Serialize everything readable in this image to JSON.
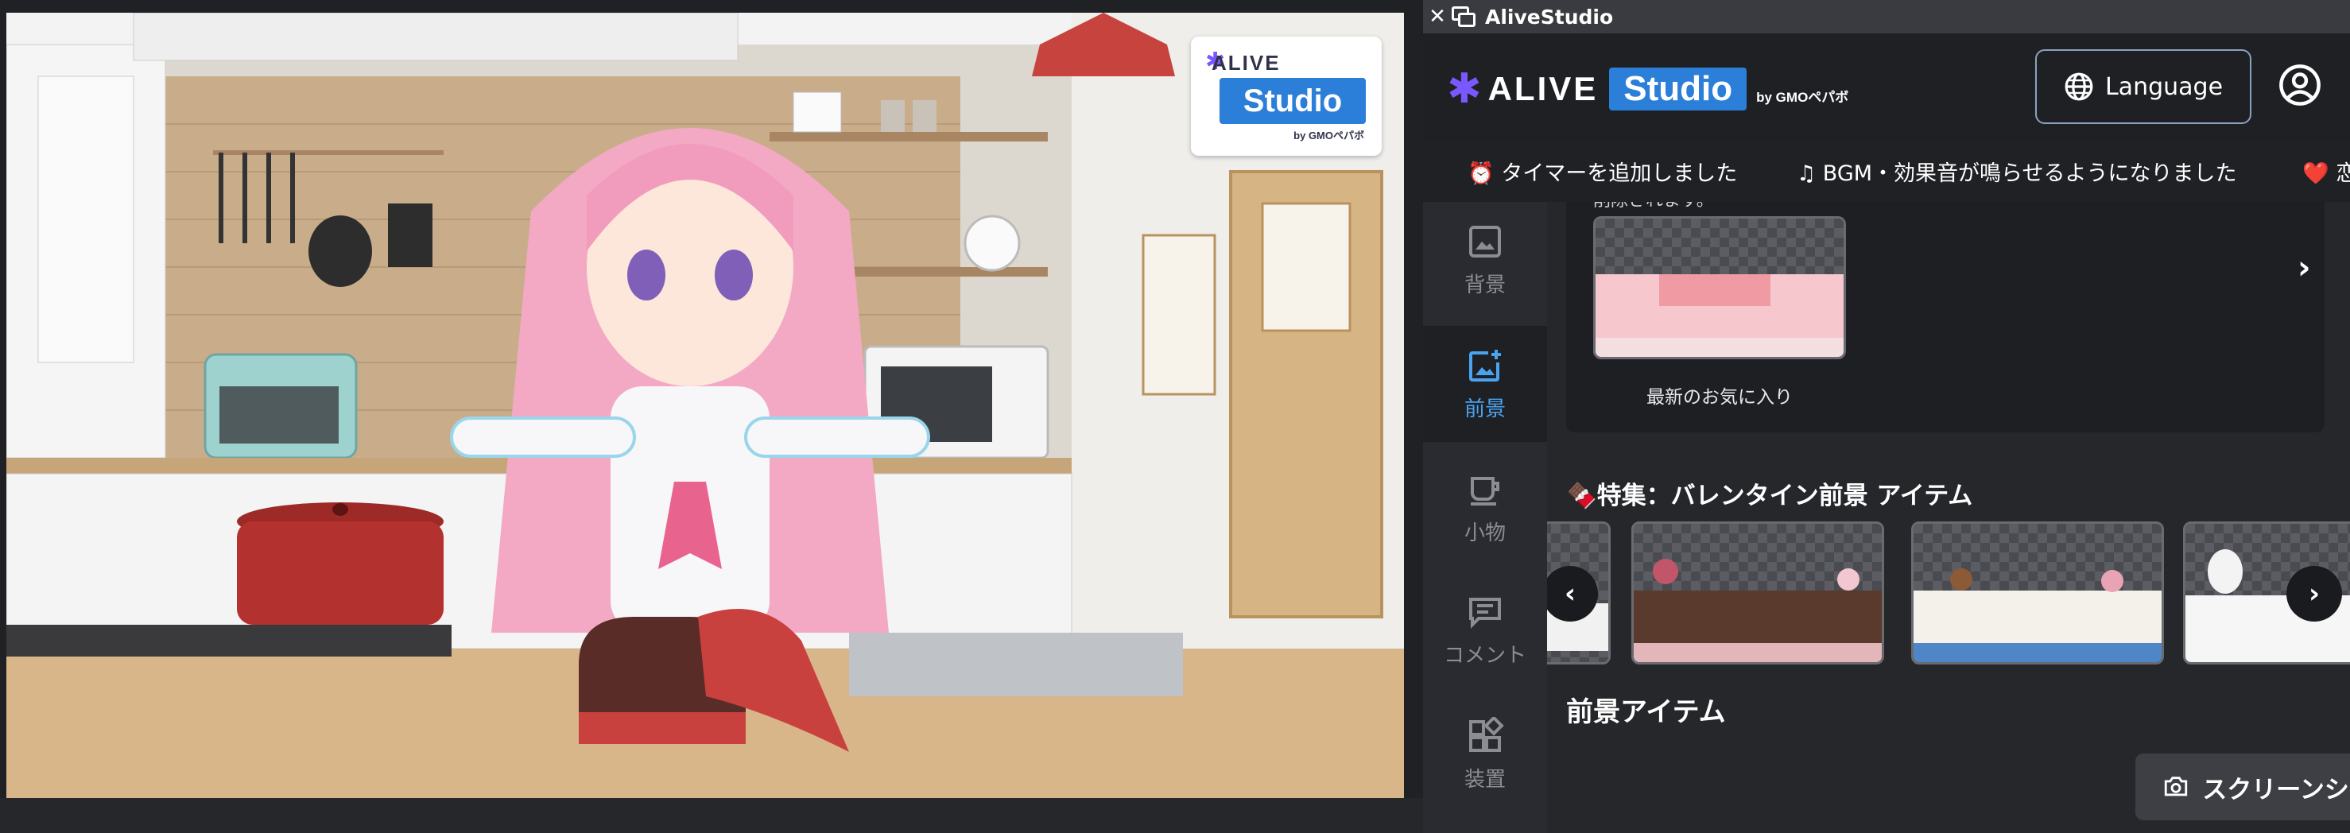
{
  "window": {
    "title": "AliveStudio",
    "close_icon": "close-icon",
    "window_icon": "window-restore-icon"
  },
  "watermark": {
    "brand": "ALIVE",
    "product": "Studio",
    "by": "by GMOペパボ"
  },
  "header": {
    "logo_brand": "ALIVE",
    "logo_product": "Studio",
    "logo_by": "by GMOペパボ",
    "language_label": "Language",
    "accent_color": "#2c7fd8",
    "logo_star_color": "#7a58ff"
  },
  "ticker": {
    "items": [
      "⏰ タイマーを追加しました",
      "♫ BGM・効果音が鳴らせるようになりました",
      "❤️ 恋"
    ]
  },
  "sidebar": {
    "items": [
      {
        "label": "背景",
        "icon": "image-icon",
        "active": false
      },
      {
        "label": "前景",
        "icon": "image-plus-icon",
        "active": true
      },
      {
        "label": "小物",
        "icon": "cup-icon",
        "active": false
      },
      {
        "label": "コメント",
        "icon": "comment-icon",
        "active": false
      },
      {
        "label": "装置",
        "icon": "widgets-icon",
        "active": false
      }
    ],
    "active_color": "#4aa3f0"
  },
  "content": {
    "favorites_note": "削除されます。",
    "favorites_label": "最新のお気に入り",
    "feature_title": "🍫特集：バレンタイン前景 アイテム",
    "items_title": "前景アイテム",
    "screenshot_label": "スクリーンショット"
  }
}
